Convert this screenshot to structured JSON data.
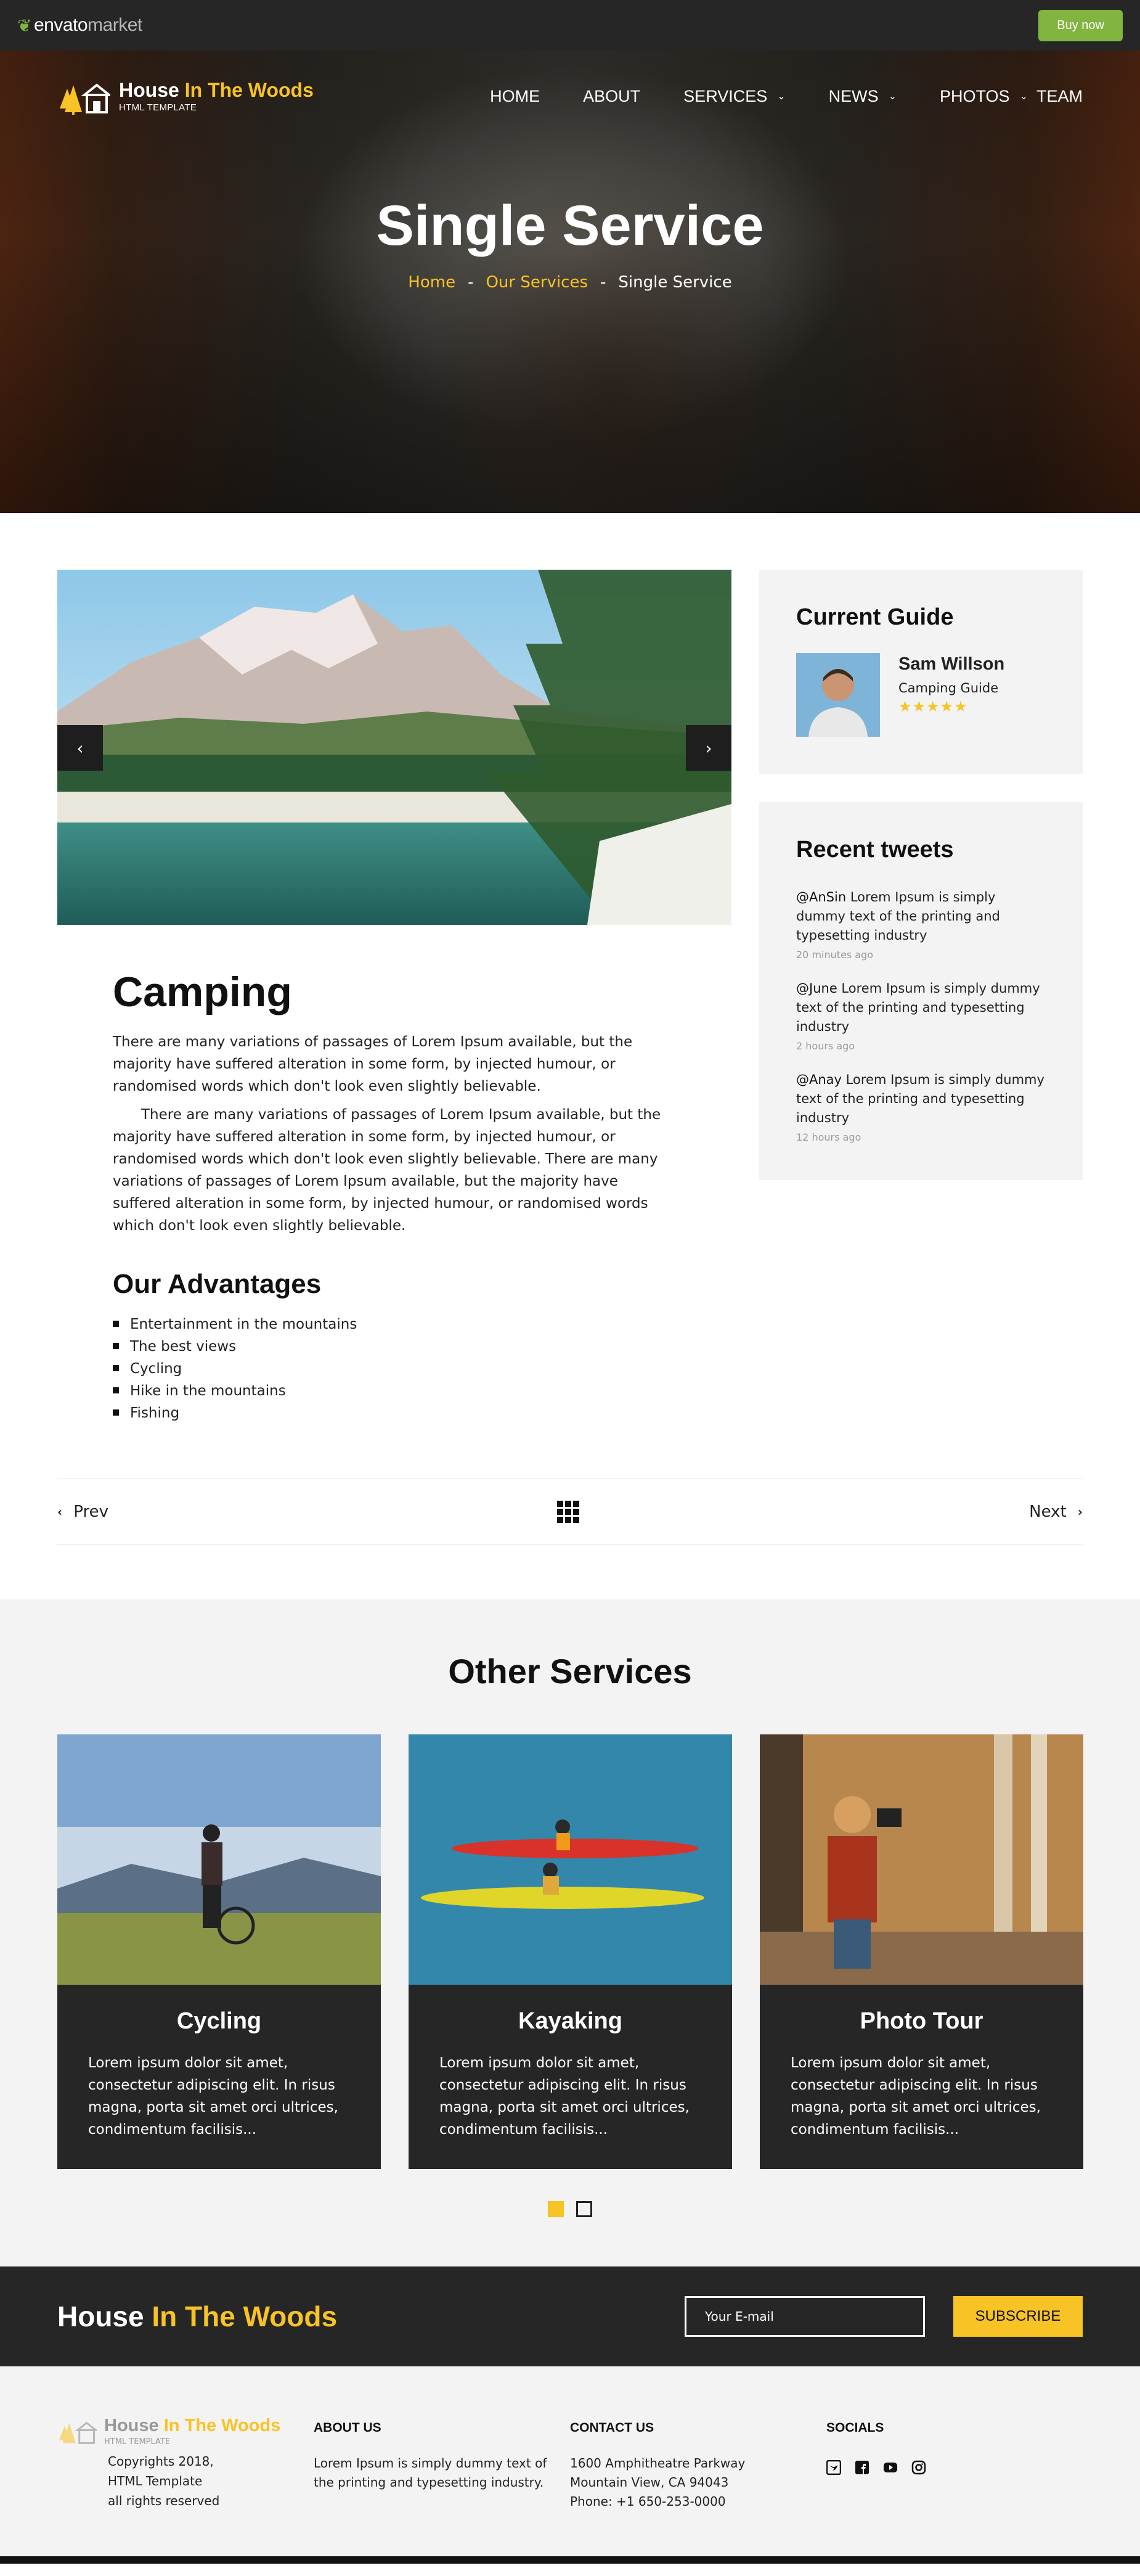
{
  "envato": {
    "brand_prefix": "envato",
    "brand_suffix": "market",
    "buy_label": "Buy now"
  },
  "brand": {
    "name_main": "House",
    "name_accent": "In The Woods",
    "subtitle": "HTML TEMPLATE"
  },
  "nav": {
    "items": [
      {
        "label": "HOME",
        "dropdown": false
      },
      {
        "label": "ABOUT",
        "dropdown": false
      },
      {
        "label": "SERVICES",
        "dropdown": true
      },
      {
        "label": "NEWS",
        "dropdown": true
      },
      {
        "label": "PHOTOS",
        "dropdown": false
      },
      {
        "label": "TEAM",
        "dropdown": true
      }
    ]
  },
  "hero": {
    "title": "Single Service",
    "breadcrumb": {
      "home": "Home",
      "section": "Our Services",
      "current": "Single Service",
      "separator": "-"
    }
  },
  "article": {
    "title": "Camping",
    "paragraph_1": "There are many variations of passages of Lorem Ipsum available, but the majority have suffered alteration in some form, by injected humour, or randomised words which don't look even slightly believable.",
    "paragraph_2": "There are many variations of passages of Lorem Ipsum available, but the majority have suffered alteration in some form, by injected humour, or randomised words which don't look even slightly believable. There are many variations of passages of Lorem Ipsum available, but the majority have suffered alteration in some form, by injected humour, or randomised words which don't look even slightly believable.",
    "advantages_title": "Our Advantages",
    "advantages": [
      "Entertainment in the mountains",
      "The best views",
      "Cycling",
      "Hike in the mountains",
      "Fishing"
    ]
  },
  "guide": {
    "title": "Current Guide",
    "name": "Sam Willson",
    "role": "Camping Guide",
    "stars": "★★★★★",
    "rating": 5
  },
  "tweets": {
    "title": "Recent tweets",
    "items": [
      {
        "handle": "@AnSin",
        "text": "Lorem Ipsum is simply dummy text of the printing and typesetting industry",
        "time": "20 minutes ago"
      },
      {
        "handle": "@June",
        "text": "Lorem Ipsum is simply dummy text of the printing and typesetting industry",
        "time": "2 hours ago"
      },
      {
        "handle": "@Anay",
        "text": "Lorem Ipsum is simply dummy text of the printing and typesetting industry",
        "time": "12 hours ago"
      }
    ]
  },
  "pager": {
    "prev": "Prev",
    "next": "Next"
  },
  "others": {
    "title": "Other Services",
    "cards": [
      {
        "title": "Cycling",
        "text": "Lorem ipsum dolor sit amet, consectetur adipiscing elit. In risus magna, porta sit amet orci ultrices, condimentum facilisis..."
      },
      {
        "title": "Kayaking",
        "text": "Lorem ipsum dolor sit amet, consectetur adipiscing elit. In risus magna, porta sit amet orci ultrices, condimentum facilisis..."
      },
      {
        "title": "Photo Tour",
        "text": "Lorem ipsum dolor sit amet, consectetur adipiscing elit. In risus magna, porta sit amet orci ultrices, condimentum facilisis..."
      }
    ]
  },
  "subscribe": {
    "placeholder": "Your E-mail",
    "button": "SUBSCRIBE"
  },
  "footer": {
    "copyright": [
      "Copyrights 2018,",
      "HTML Template",
      "all rights reserved"
    ],
    "about_title": "ABOUT US",
    "about_text": "Lorem Ipsum is simply dummy text of the printing and typesetting industry.",
    "contact_title": "CONTACT US",
    "contact_lines": [
      "1600 Amphitheatre Parkway",
      "Mountain View, CA 94043",
      "Phone: +1 650-253-0000"
    ],
    "socials_title": "SOCIALS",
    "socials": [
      "twitter-icon",
      "facebook-icon",
      "youtube-icon",
      "instagram-icon"
    ]
  },
  "colors": {
    "accent": "#f7c325",
    "dark": "#262626",
    "light": "#f3f3f3",
    "envato_green": "#82b440"
  }
}
